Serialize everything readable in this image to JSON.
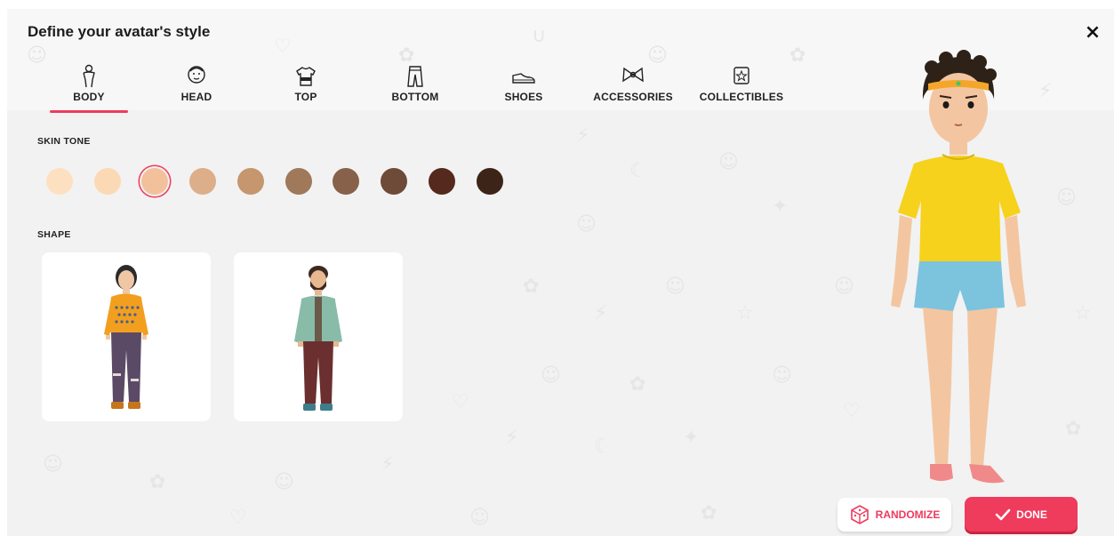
{
  "header": {
    "title": "Define your avatar's style",
    "close_label": "×"
  },
  "tabs": [
    {
      "label": "BODY",
      "icon": "body-icon",
      "active": true
    },
    {
      "label": "HEAD",
      "icon": "head-icon",
      "active": false
    },
    {
      "label": "TOP",
      "icon": "shirt-icon",
      "active": false
    },
    {
      "label": "BOTTOM",
      "icon": "pants-icon",
      "active": false
    },
    {
      "label": "SHOES",
      "icon": "shoe-icon",
      "active": false
    },
    {
      "label": "ACCESSORIES",
      "icon": "bow-icon",
      "active": false
    },
    {
      "label": "COLLECTIBLES",
      "icon": "star-box-icon",
      "active": false
    }
  ],
  "skin_tone": {
    "label": "SKIN TONE",
    "selected_index": 2,
    "colors": [
      "#fde0c0",
      "#fbd9b5",
      "#f2c19c",
      "#dcae8a",
      "#c6966e",
      "#a0785a",
      "#87614a",
      "#6e4a38",
      "#55291d",
      "#3d2418"
    ]
  },
  "shape": {
    "label": "SHAPE",
    "options": [
      {
        "name": "feminine-body-shape",
        "shirt_color": "#f29f1f",
        "pants_color": "#5b4a66",
        "hair_color": "#2b2b2b"
      },
      {
        "name": "masculine-body-shape",
        "shirt_color": "#88bca8",
        "pants_color": "#6b2f2f",
        "hair_color": "#3a2a22"
      }
    ]
  },
  "buttons": {
    "randomize": "RANDOMIZE",
    "done": "DONE"
  },
  "colors": {
    "accent": "#ef3b5c",
    "avatar_shirt": "#f6d21c",
    "avatar_shorts": "#7cc3de",
    "avatar_skin": "#f3c6a1",
    "avatar_headband": "#f4a62a"
  }
}
